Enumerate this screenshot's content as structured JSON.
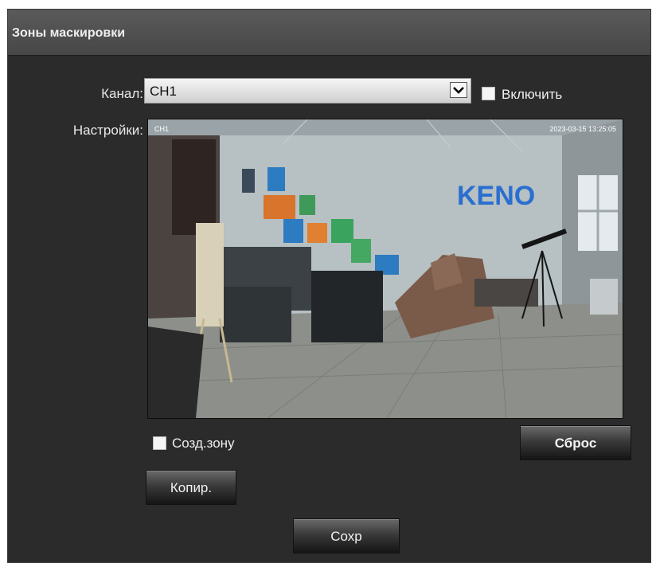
{
  "header": {
    "title": "Зоны маскировки"
  },
  "form": {
    "channel_label": "Канал:",
    "channel_value": "CH1",
    "enable_label": "Включить",
    "settings_label": "Настройки:",
    "create_zone_label": "Созд.зону",
    "reset_label": "Сброс",
    "copy_label": "Копир.",
    "save_label": "Сохр"
  },
  "preview": {
    "wall_logo_text": "KENO",
    "overlay_channel": "CH1",
    "overlay_timestamp": "2023-03-15 13:25:05"
  },
  "icons": {
    "select_arrow": "chevron-down-icon"
  },
  "colors": {
    "panel_bg": "#2b2b2b",
    "header_bg": "#505050",
    "text": "#f0f0f0",
    "logo_blue": "#2a6fd0"
  }
}
